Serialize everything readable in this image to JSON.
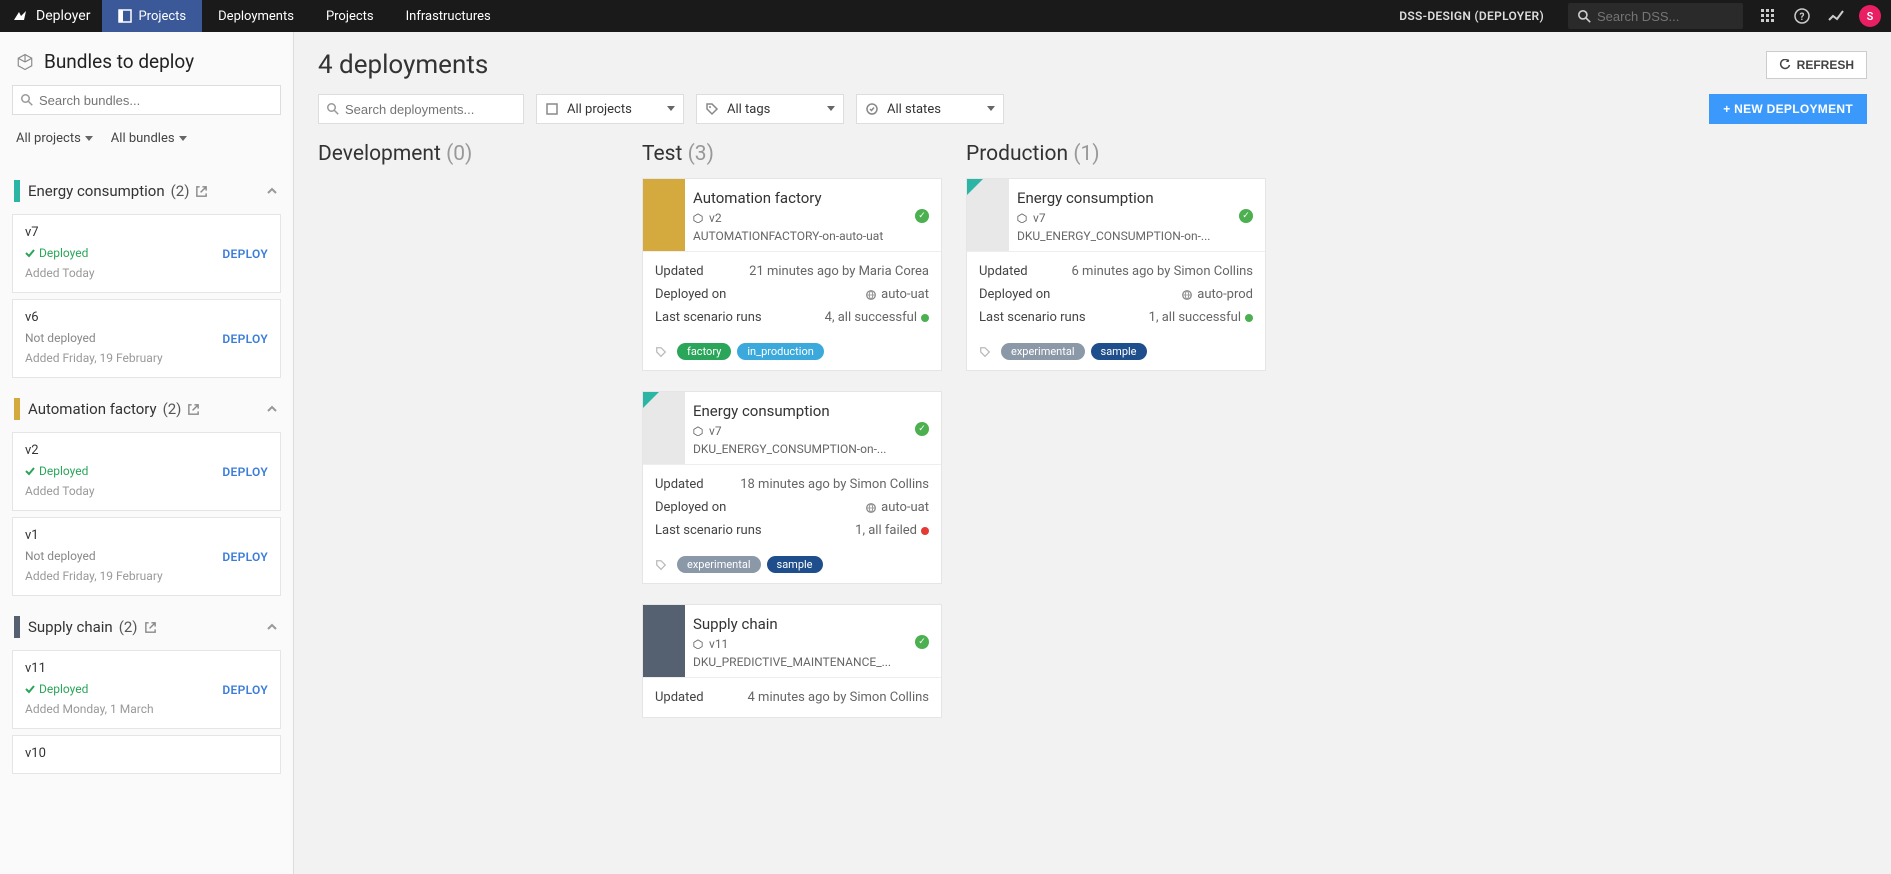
{
  "topnav": {
    "logo_text": "Deployer",
    "tabs": [
      {
        "label": "Projects",
        "active": true
      },
      {
        "label": "Deployments"
      },
      {
        "label": "Projects"
      },
      {
        "label": "Infrastructures"
      }
    ],
    "design_label": "DSS-DESIGN (DEPLOYER)",
    "search_placeholder": "Search DSS...",
    "avatar_initial": "S"
  },
  "sidebar": {
    "title": "Bundles to deploy",
    "search_placeholder": "Search bundles...",
    "filter_projects": "All projects",
    "filter_bundles": "All bundles",
    "groups": [
      {
        "name": "Energy consumption",
        "count": "(2)",
        "color": "#2ab5a5",
        "bundles": [
          {
            "version": "v7",
            "status": "Deployed",
            "deployed": true,
            "added": "Added Today",
            "deploy_label": "DEPLOY"
          },
          {
            "version": "v6",
            "status": "Not deployed",
            "deployed": false,
            "added": "Added Friday, 19 February",
            "deploy_label": "DEPLOY"
          }
        ]
      },
      {
        "name": "Automation factory",
        "count": "(2)",
        "color": "#d4a93e",
        "bundles": [
          {
            "version": "v2",
            "status": "Deployed",
            "deployed": true,
            "added": "Added Today",
            "deploy_label": "DEPLOY"
          },
          {
            "version": "v1",
            "status": "Not deployed",
            "deployed": false,
            "added": "Added Friday, 19 February",
            "deploy_label": "DEPLOY"
          }
        ]
      },
      {
        "name": "Supply chain",
        "count": "(2)",
        "color": "#556070",
        "bundles": [
          {
            "version": "v11",
            "status": "Deployed",
            "deployed": true,
            "added": "Added Monday, 1 March",
            "deploy_label": "DEPLOY"
          },
          {
            "version": "v10",
            "status": "",
            "deployed": false,
            "added": "",
            "deploy_label": ""
          }
        ]
      }
    ]
  },
  "content": {
    "title": "4 deployments",
    "refresh_label": "REFRESH",
    "search_placeholder": "Search deployments...",
    "filter_projects": "All projects",
    "filter_tags": "All tags",
    "filter_states": "All states",
    "new_deploy_label": "+ NEW DEPLOYMENT",
    "stages": [
      {
        "name": "Development",
        "count": "(0)",
        "cards": []
      },
      {
        "name": "Test",
        "count": "(3)",
        "cards": [
          {
            "title": "Automation factory",
            "version": "v2",
            "key": "AUTOMATIONFACTORY-on-auto-uat",
            "thumb_color": "#d4a93e",
            "updated_label": "Updated",
            "updated_val": "21 minutes ago by Maria Corea",
            "deployed_label": "Deployed on",
            "deployed_val": "auto-uat",
            "runs_label": "Last scenario runs",
            "runs_val": "4, all successful",
            "runs_dot": "green",
            "tags": [
              {
                "text": "factory",
                "color": "#2aa55a"
              },
              {
                "text": "in_production",
                "color": "#3ba9dc"
              }
            ]
          },
          {
            "title": "Energy consumption",
            "version": "v7",
            "key": "DKU_ENERGY_CONSUMPTION-on-...",
            "thumb_color": "#e8e8e8",
            "corner": true,
            "updated_label": "Updated",
            "updated_val": "18 minutes ago by Simon Collins",
            "deployed_label": "Deployed on",
            "deployed_val": "auto-uat",
            "runs_label": "Last scenario runs",
            "runs_val": "1, all failed",
            "runs_dot": "red",
            "tags": [
              {
                "text": "experimental",
                "color": "#8a98a8"
              },
              {
                "text": "sample",
                "color": "#1f4e8c"
              }
            ]
          },
          {
            "title": "Supply chain",
            "version": "v11",
            "key": "DKU_PREDICTIVE_MAINTENANCE_...",
            "thumb_color": "#556070",
            "updated_label": "Updated",
            "updated_val": "4 minutes ago by Simon Collins",
            "deployed_label": "",
            "deployed_val": "",
            "runs_label": "",
            "runs_val": "",
            "tags": []
          }
        ]
      },
      {
        "name": "Production",
        "count": "(1)",
        "cards": [
          {
            "title": "Energy consumption",
            "version": "v7",
            "key": "DKU_ENERGY_CONSUMPTION-on-...",
            "thumb_color": "#e8e8e8",
            "corner": true,
            "updated_label": "Updated",
            "updated_val": "6 minutes ago by Simon Collins",
            "deployed_label": "Deployed on",
            "deployed_val": "auto-prod",
            "runs_label": "Last scenario runs",
            "runs_val": "1, all successful",
            "runs_dot": "green",
            "tags": [
              {
                "text": "experimental",
                "color": "#8a98a8"
              },
              {
                "text": "sample",
                "color": "#1f4e8c"
              }
            ]
          }
        ]
      }
    ]
  }
}
